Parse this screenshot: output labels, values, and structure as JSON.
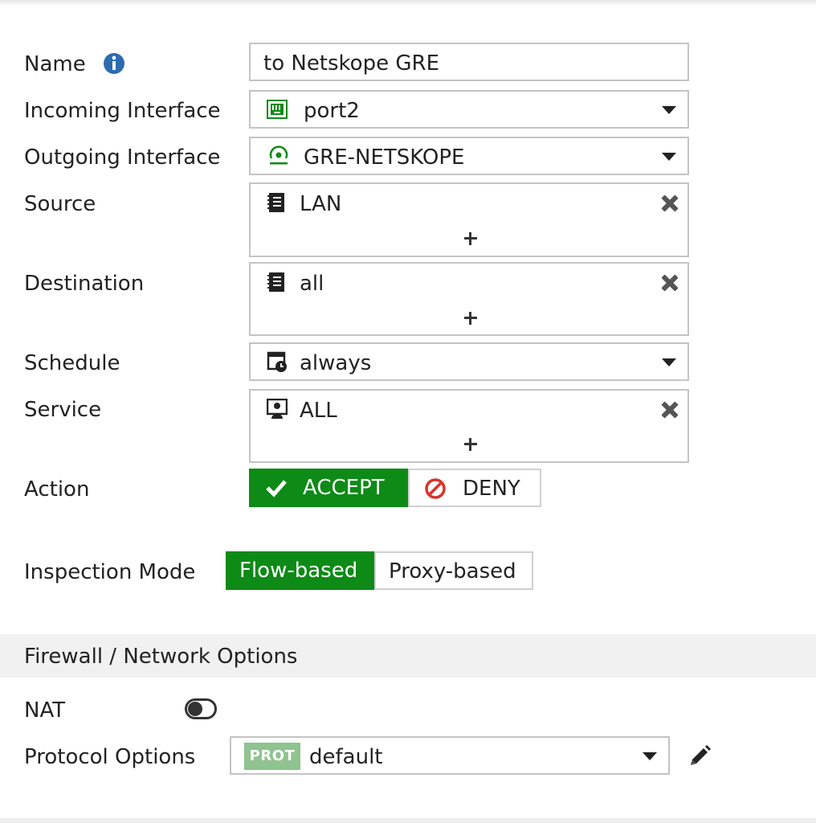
{
  "form": {
    "name": {
      "label": "Name",
      "value": "to Netskope GRE"
    },
    "incoming_interface": {
      "label": "Incoming Interface",
      "value": "port2"
    },
    "outgoing_interface": {
      "label": "Outgoing Interface",
      "value": "GRE-NETSKOPE"
    },
    "source": {
      "label": "Source",
      "item": "LAN"
    },
    "destination": {
      "label": "Destination",
      "item": "all"
    },
    "schedule": {
      "label": "Schedule",
      "value": "always"
    },
    "service": {
      "label": "Service",
      "item": "ALL"
    },
    "action": {
      "label": "Action",
      "accept": "ACCEPT",
      "deny": "DENY",
      "selected": "ACCEPT"
    },
    "inspection_mode": {
      "label": "Inspection Mode",
      "flow": "Flow-based",
      "proxy": "Proxy-based",
      "selected": "Flow-based"
    }
  },
  "firewall_section": {
    "title": "Firewall / Network Options",
    "nat": {
      "label": "NAT",
      "enabled": false
    },
    "protocol_options": {
      "label": "Protocol Options",
      "badge": "PROT",
      "value": "default"
    }
  },
  "colors": {
    "accent_green": "#0e8a16",
    "info_blue": "#2b6cb0",
    "deny_red": "#d9342b",
    "prot_badge": "#8fc38f"
  }
}
